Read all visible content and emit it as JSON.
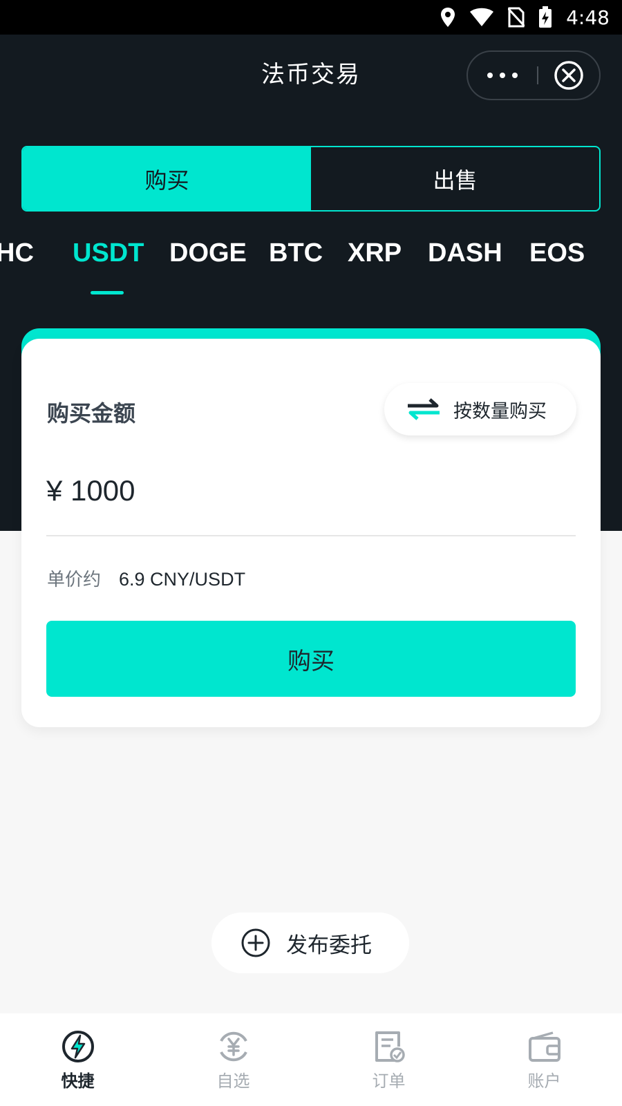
{
  "status_bar": {
    "time": "4:48"
  },
  "header": {
    "title": "法币交易"
  },
  "trade_toggle": {
    "buy_label": "购买",
    "sell_label": "出售"
  },
  "coins": [
    "HC",
    "USDT",
    "DOGE",
    "BTC",
    "XRP",
    "DASH",
    "EOS"
  ],
  "coins_selected": "USDT",
  "card": {
    "amount_label": "购买金额",
    "switch_label": "按数量购买",
    "amount_value": "¥ 1000",
    "price_label": "单价约",
    "price_value": "6.9 CNY/USDT",
    "buy_button": "购买"
  },
  "publish_label": "发布委托",
  "tabs": [
    {
      "label": "快捷",
      "icon": "lightning-icon"
    },
    {
      "label": "自选",
      "icon": "yuan-exchange-icon"
    },
    {
      "label": "订单",
      "icon": "order-document-icon"
    },
    {
      "label": "账户",
      "icon": "wallet-icon"
    }
  ],
  "colors": {
    "accent": "#00e6cf",
    "dark_bg": "#131a20",
    "page_bg": "#f7f7f7"
  }
}
